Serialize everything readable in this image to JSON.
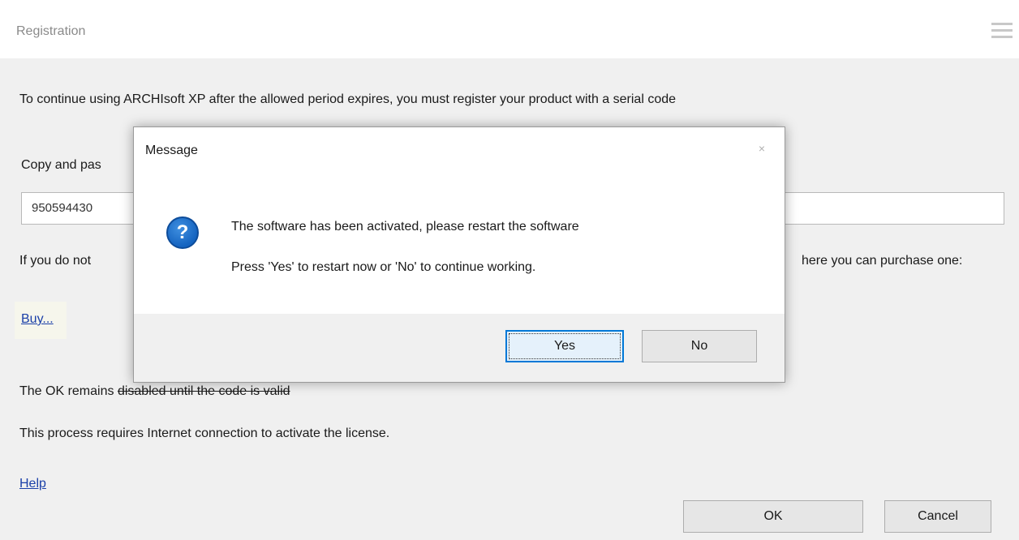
{
  "registration": {
    "title": "Registration",
    "intro": "To continue using ARCHIsoft XP after the allowed period expires, you must register your product with a serial code",
    "copy_label": "Copy and pas",
    "serial_value": "950594430",
    "ifyou_fragment": "If you do not",
    "purchase_fragment": "here you can purchase one:",
    "buy_link": "Buy...",
    "ok_note_prefix": "The OK remains ",
    "ok_note_struck": "disabled until the code is valid",
    "internet_note": "This process requires Internet connection to activate the license.",
    "help_link": "Help",
    "ok_label": "OK",
    "cancel_label": "Cancel"
  },
  "message": {
    "title": "Message",
    "close_glyph": "×",
    "icon": "question-icon",
    "icon_glyph": "?",
    "line1": "The software has been activated, please restart the software",
    "line2": "Press 'Yes' to restart now or 'No' to continue working.",
    "yes_label": "Yes",
    "no_label": "No"
  },
  "colors": {
    "accent": "#0078d7",
    "link": "#1a3fa8",
    "icon_blue": "#1564c0"
  }
}
